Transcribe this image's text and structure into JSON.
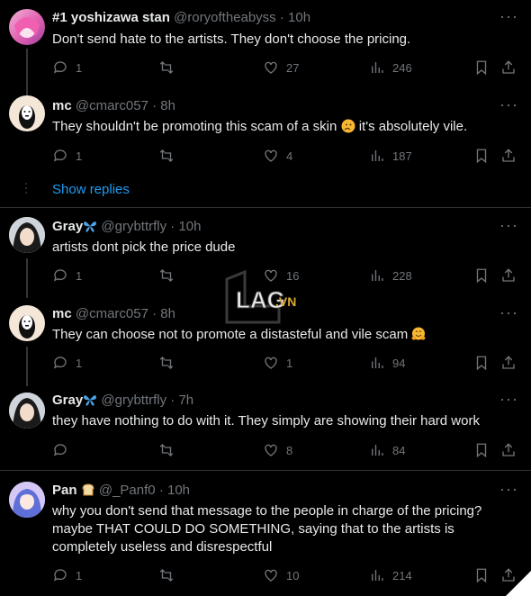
{
  "tweets": [
    {
      "name": "#1 yoshizawa stan",
      "handle": "@roryoftheabyss",
      "dot": "·",
      "time": "10h",
      "text": "Don't send hate to the artists. They don't choose the pricing.",
      "replies": "1",
      "retweets": "",
      "likes": "27",
      "views": "246"
    },
    {
      "name": "mc",
      "handle": "@cmarc057",
      "dot": "·",
      "time": "8h",
      "text_before": "They shouldn't be promoting this scam of a skin",
      "text_after": " it's absolutely vile.",
      "replies": "1",
      "retweets": "",
      "likes": "4",
      "views": "187"
    },
    {
      "name": "Gray",
      "handle": "@grybttrfly",
      "dot": "·",
      "time": "10h",
      "text": "artists dont pick the price dude",
      "replies": "1",
      "retweets": "",
      "likes": "16",
      "views": "228"
    },
    {
      "name": "mc",
      "handle": "@cmarc057",
      "dot": "·",
      "time": "8h",
      "text": "They can choose not to promote a distasteful and vile scam",
      "replies": "1",
      "retweets": "",
      "likes": "1",
      "views": "94"
    },
    {
      "name": "Gray",
      "handle": "@grybttrfly",
      "dot": "·",
      "time": "7h",
      "text": "they have nothing to do with it. They simply are showing their hard work",
      "replies": "",
      "retweets": "",
      "likes": "8",
      "views": "84"
    },
    {
      "name": "Pan",
      "handle": "@_Panf0",
      "dot": "·",
      "time": "10h",
      "text": "why you don't send that message to the people in charge of the pricing? maybe THAT COULD DO SOMETHING, saying that to the artists is completely useless and disrespectful",
      "replies": "1",
      "retweets": "",
      "likes": "10",
      "views": "214"
    }
  ],
  "show_replies": "Show replies",
  "more": "···",
  "watermark": "LAG.VN",
  "colors": {
    "background": "#000000",
    "text": "#e7e9ea",
    "muted": "#71767b",
    "link": "#1d9bf0",
    "divider": "#2f3336"
  }
}
